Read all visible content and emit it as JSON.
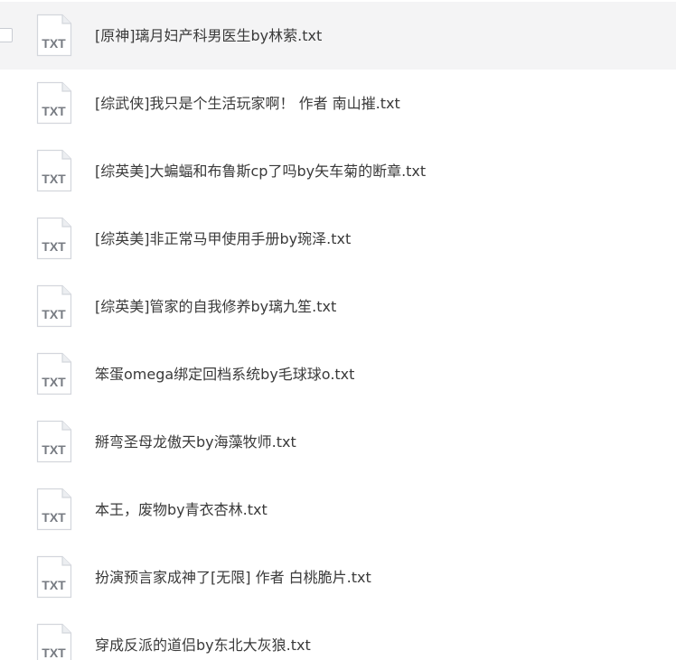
{
  "files": [
    {
      "name": "[原神]璃月妇产科男医生by林萦.txt",
      "icon": "txt-file-icon",
      "icon_label": "TXT",
      "selected": true
    },
    {
      "name": "[综武侠]我只是个生活玩家啊！ 作者 南山摧.txt",
      "icon": "txt-file-icon",
      "icon_label": "TXT"
    },
    {
      "name": "[综英美]大蝙蝠和布鲁斯cp了吗by矢车菊的断章.txt",
      "icon": "txt-file-icon",
      "icon_label": "TXT"
    },
    {
      "name": "[综英美]非正常马甲使用手册by琬泽.txt",
      "icon": "txt-file-icon",
      "icon_label": "TXT"
    },
    {
      "name": "[综英美]管家的自我修养by璃九笙.txt",
      "icon": "txt-file-icon",
      "icon_label": "TXT"
    },
    {
      "name": "笨蛋omega绑定回档系统by毛球球o.txt",
      "icon": "txt-file-icon",
      "icon_label": "TXT"
    },
    {
      "name": "掰弯圣母龙傲天by海藻牧师.txt",
      "icon": "txt-file-icon",
      "icon_label": "TXT"
    },
    {
      "name": "本王，废物by青衣杏林.txt",
      "icon": "txt-file-icon",
      "icon_label": "TXT"
    },
    {
      "name": "扮演预言家成神了[无限] 作者 白桃脆片.txt",
      "icon": "txt-file-icon",
      "icon_label": "TXT"
    },
    {
      "name": "穿成反派的道侣by东北大灰狼.txt",
      "icon": "txt-file-icon",
      "icon_label": "TXT"
    }
  ]
}
